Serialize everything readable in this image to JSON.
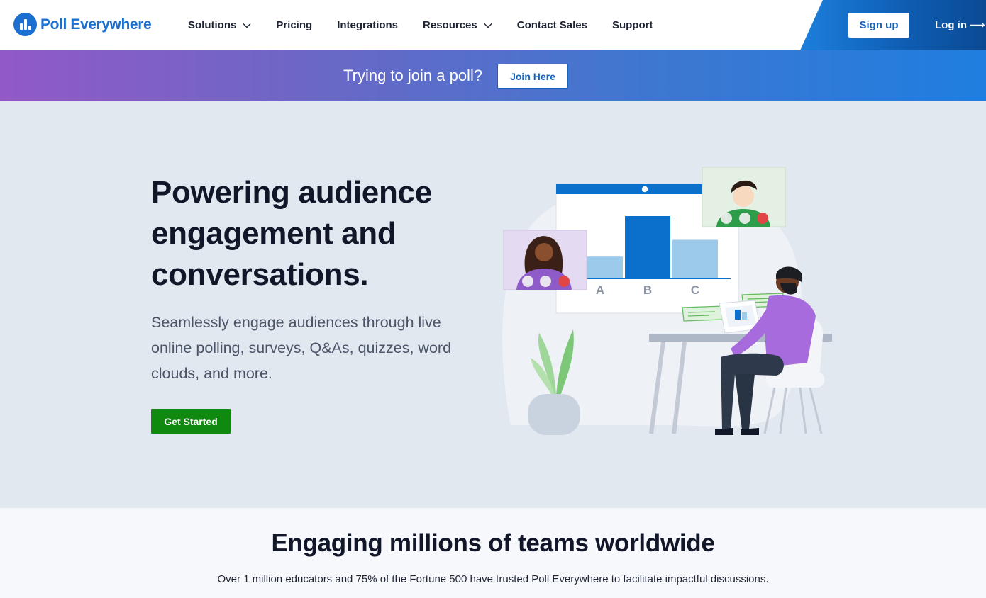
{
  "brand": {
    "name": "Poll Everywhere",
    "color": "#1a6fd1"
  },
  "nav": {
    "items": [
      {
        "label": "Solutions",
        "has_dropdown": true
      },
      {
        "label": "Pricing",
        "has_dropdown": false
      },
      {
        "label": "Integrations",
        "has_dropdown": false
      },
      {
        "label": "Resources",
        "has_dropdown": true
      },
      {
        "label": "Contact Sales",
        "has_dropdown": false
      },
      {
        "label": "Support",
        "has_dropdown": false
      }
    ],
    "signup_label": "Sign up",
    "login_label": "Log in",
    "login_arrow": "⟶"
  },
  "banner": {
    "text": "Trying to join a poll?",
    "button_label": "Join Here"
  },
  "hero": {
    "title": "Powering audience engagement and conversations.",
    "description": "Seamlessly engage audiences through live online polling, surveys, Q&As, quizzes, word clouds, and more.",
    "cta_label": "Get Started",
    "cta_color": "#0f8a0f",
    "illustration": {
      "poll_labels": [
        "A",
        "B",
        "C"
      ],
      "poll_values": [
        0.35,
        1.0,
        0.62
      ],
      "bar_colors": [
        "#9ccaeb",
        "#0b6fcc",
        "#9ccaeb"
      ]
    }
  },
  "stats": {
    "title": "Engaging millions of teams worldwide",
    "text": "Over 1 million educators and 75% of the Fortune 500 have trusted Poll Everywhere to facilitate impactful discussions."
  }
}
